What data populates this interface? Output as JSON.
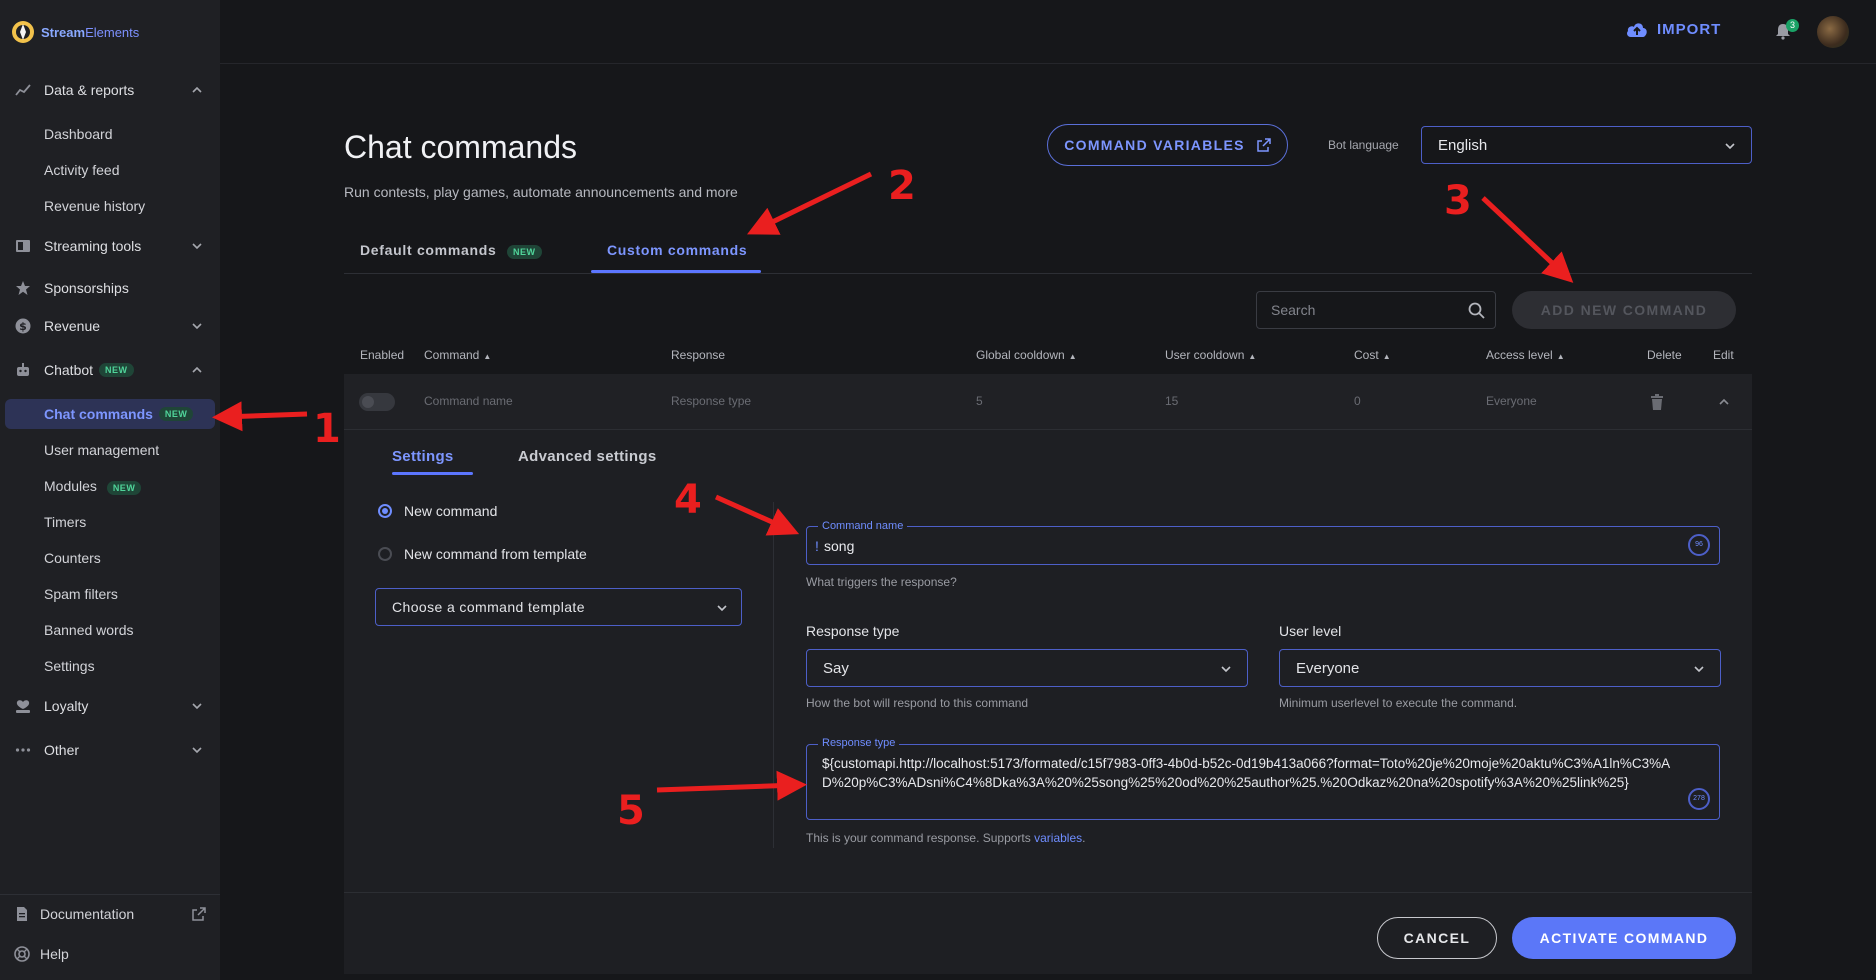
{
  "brand": {
    "name_a": "Stream",
    "name_b": "Elements"
  },
  "sidebar": {
    "sections": [
      {
        "label": "Data & reports",
        "icon": "trend-icon"
      },
      {
        "label": "Streaming tools",
        "icon": "streaming-tools-icon"
      },
      {
        "label": "Sponsorships",
        "icon": "star-icon"
      },
      {
        "label": "Revenue",
        "icon": "dollar-icon"
      },
      {
        "label": "Chatbot",
        "icon": "robot-icon",
        "badge": "NEW"
      },
      {
        "label": "Loyalty",
        "icon": "loyalty-icon"
      },
      {
        "label": "Other",
        "icon": "more-icon"
      }
    ],
    "data_items": [
      "Dashboard",
      "Activity feed",
      "Revenue history"
    ],
    "chatbot_items": [
      {
        "label": "Chat commands",
        "badge": "NEW",
        "active": true
      },
      {
        "label": "User management"
      },
      {
        "label": "Modules",
        "badge": "NEW"
      },
      {
        "label": "Timers"
      },
      {
        "label": "Counters"
      },
      {
        "label": "Spam filters"
      },
      {
        "label": "Banned words"
      },
      {
        "label": "Settings"
      }
    ],
    "bottom": [
      {
        "label": "Documentation",
        "icon": "document-icon"
      },
      {
        "label": "Help",
        "icon": "help-icon"
      }
    ]
  },
  "topbar": {
    "import_label": "IMPORT",
    "notification_count": "3"
  },
  "header": {
    "title": "Chat commands",
    "subtitle": "Run contests, play games, automate announcements and more",
    "command_variables_label": "COMMAND VARIABLES",
    "bot_language_label": "Bot language",
    "bot_language_value": "English"
  },
  "tabs": [
    {
      "label": "Default commands",
      "badge": "NEW"
    },
    {
      "label": "Custom commands",
      "active": true
    }
  ],
  "search": {
    "placeholder": "Search"
  },
  "add_new_label": "ADD NEW COMMAND",
  "table": {
    "headers": {
      "enabled": "Enabled",
      "command": "Command",
      "response": "Response",
      "global_cooldown": "Global cooldown",
      "user_cooldown": "User cooldown",
      "cost": "Cost",
      "access_level": "Access level",
      "delete": "Delete",
      "edit": "Edit"
    },
    "row": {
      "command": "Command name",
      "response": "Response type",
      "global_cooldown": "5",
      "user_cooldown": "15",
      "cost": "0",
      "access_level": "Everyone"
    }
  },
  "editor": {
    "tabs": [
      "Settings",
      "Advanced settings"
    ],
    "radio_new": "New command",
    "radio_template": "New command from template",
    "template_select": "Choose a command template",
    "command_name_label": "Command name",
    "command_prefix": "!",
    "command_name_value": "song",
    "command_name_counter": "96",
    "command_name_hint": "What triggers the response?",
    "response_type_title": "Response type",
    "response_type_value": "Say",
    "response_type_hint": "How the bot will respond to this command",
    "user_level_title": "User level",
    "user_level_value": "Everyone",
    "user_level_hint": "Minimum userlevel to execute the command.",
    "response_label": "Response type",
    "response_value": "${customapi.http://localhost:5173/formated/c15f7983-0ff3-4b0d-b52c-0d19b413a066?format=Toto%20je%20moje%20aktu%C3%A1ln%C3%AD%20p%C3%ADsni%C4%8Dka%3A%20%25song%25%20od%20%25author%25.%20Odkaz%20na%20spotify%3A%20%25link%25}",
    "response_counter": "278",
    "response_hint": "This is your command response. Supports",
    "response_hint_link": "variables",
    "cancel_label": "CANCEL",
    "activate_label": "ACTIVATE COMMAND"
  },
  "annotations": [
    "1",
    "2",
    "3",
    "4",
    "5"
  ],
  "colors": {
    "accent": "#5c76ff",
    "annotation": "#ea1f1f",
    "new_badge": "#50d49a"
  }
}
